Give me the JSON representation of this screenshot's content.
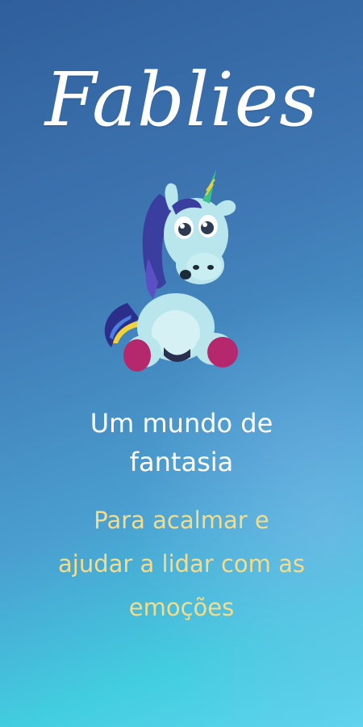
{
  "brand": {
    "logo_text": "Fablies"
  },
  "mascot": {
    "name": "unicorn-mascot"
  },
  "hero": {
    "headline_line1": "Um mundo de",
    "headline_line2": "fantasia",
    "subline_line1": "Para acalmar e",
    "subline_line2": "ajudar a lidar com as",
    "subline_line3": "emoções"
  },
  "colors": {
    "background_top": "#2f5f9c",
    "background_bottom": "#42cde0",
    "headline": "#ffffff",
    "subline": "#f4dc8a"
  }
}
